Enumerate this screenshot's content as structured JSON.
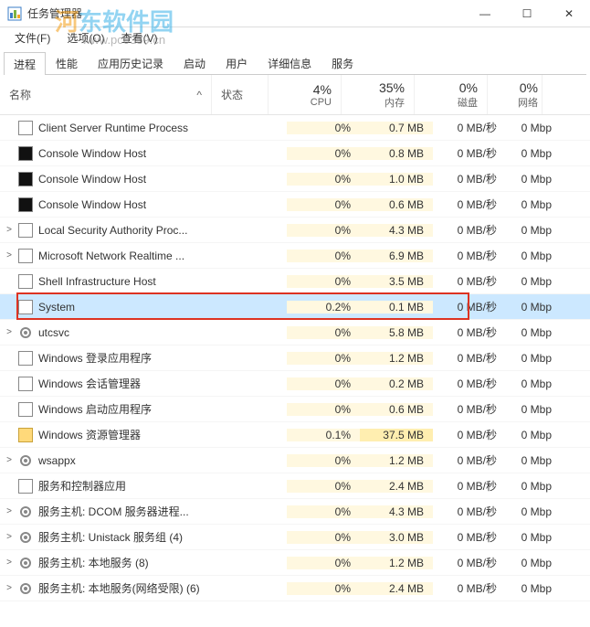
{
  "watermark": {
    "part1": "河",
    "part2": "东软件园",
    "url": "www.pc0359.cn"
  },
  "window": {
    "title": "任务管理器"
  },
  "menu": {
    "file": "文件(F)",
    "options": "选项(O)",
    "view": "查看(V)"
  },
  "win_controls": {
    "min": "—",
    "max": "☐",
    "close": "✕"
  },
  "tabs_list": [
    {
      "label": "进程",
      "active": true
    },
    {
      "label": "性能",
      "active": false
    },
    {
      "label": "应用历史记录",
      "active": false
    },
    {
      "label": "启动",
      "active": false
    },
    {
      "label": "用户",
      "active": false
    },
    {
      "label": "详细信息",
      "active": false
    },
    {
      "label": "服务",
      "active": false
    }
  ],
  "columns": {
    "name": "名称",
    "status": "状态",
    "cpu": {
      "pct": "4%",
      "label": "CPU"
    },
    "mem": {
      "pct": "35%",
      "label": "内存"
    },
    "disk": {
      "pct": "0%",
      "label": "磁盘"
    },
    "net": {
      "pct": "0%",
      "label": "网络"
    }
  },
  "processes": [
    {
      "expand": "",
      "icon": "app",
      "name": "Client Server Runtime Process",
      "cpu": "0%",
      "mem": "0.7 MB",
      "disk": "0 MB/秒",
      "net": "0 Mbp",
      "cpu_hl": 1,
      "mem_hl": 1,
      "selected": false
    },
    {
      "expand": "",
      "icon": "cmd",
      "name": "Console Window Host",
      "cpu": "0%",
      "mem": "0.8 MB",
      "disk": "0 MB/秒",
      "net": "0 Mbp",
      "cpu_hl": 1,
      "mem_hl": 1
    },
    {
      "expand": "",
      "icon": "cmd",
      "name": "Console Window Host",
      "cpu": "0%",
      "mem": "1.0 MB",
      "disk": "0 MB/秒",
      "net": "0 Mbp",
      "cpu_hl": 1,
      "mem_hl": 1
    },
    {
      "expand": "",
      "icon": "cmd",
      "name": "Console Window Host",
      "cpu": "0%",
      "mem": "0.6 MB",
      "disk": "0 MB/秒",
      "net": "0 Mbp",
      "cpu_hl": 1,
      "mem_hl": 1
    },
    {
      "expand": ">",
      "icon": "app",
      "name": "Local Security Authority Proc...",
      "cpu": "0%",
      "mem": "4.3 MB",
      "disk": "0 MB/秒",
      "net": "0 Mbp",
      "cpu_hl": 1,
      "mem_hl": 1
    },
    {
      "expand": ">",
      "icon": "app",
      "name": "Microsoft Network Realtime ...",
      "cpu": "0%",
      "mem": "6.9 MB",
      "disk": "0 MB/秒",
      "net": "0 Mbp",
      "cpu_hl": 1,
      "mem_hl": 1
    },
    {
      "expand": "",
      "icon": "app",
      "name": "Shell Infrastructure Host",
      "cpu": "0%",
      "mem": "3.5 MB",
      "disk": "0 MB/秒",
      "net": "0 Mbp",
      "cpu_hl": 1,
      "mem_hl": 1
    },
    {
      "expand": "",
      "icon": "app",
      "name": "System",
      "cpu": "0.2%",
      "mem": "0.1 MB",
      "disk": "0 MB/秒",
      "net": "0 Mbp",
      "cpu_hl": 1,
      "mem_hl": 1,
      "selected": true,
      "highlight": true
    },
    {
      "expand": ">",
      "icon": "gear",
      "name": "utcsvc",
      "cpu": "0%",
      "mem": "5.8 MB",
      "disk": "0 MB/秒",
      "net": "0 Mbp",
      "cpu_hl": 1,
      "mem_hl": 1
    },
    {
      "expand": "",
      "icon": "app",
      "name": "Windows 登录应用程序",
      "cpu": "0%",
      "mem": "1.2 MB",
      "disk": "0 MB/秒",
      "net": "0 Mbp",
      "cpu_hl": 1,
      "mem_hl": 1
    },
    {
      "expand": "",
      "icon": "app",
      "name": "Windows 会话管理器",
      "cpu": "0%",
      "mem": "0.2 MB",
      "disk": "0 MB/秒",
      "net": "0 Mbp",
      "cpu_hl": 1,
      "mem_hl": 1
    },
    {
      "expand": "",
      "icon": "app",
      "name": "Windows 启动应用程序",
      "cpu": "0%",
      "mem": "0.6 MB",
      "disk": "0 MB/秒",
      "net": "0 Mbp",
      "cpu_hl": 1,
      "mem_hl": 1
    },
    {
      "expand": "",
      "icon": "folder",
      "name": "Windows 资源管理器",
      "cpu": "0.1%",
      "mem": "37.5 MB",
      "disk": "0 MB/秒",
      "net": "0 Mbp",
      "cpu_hl": 1,
      "mem_hl": 2
    },
    {
      "expand": ">",
      "icon": "gear",
      "name": "wsappx",
      "cpu": "0%",
      "mem": "1.2 MB",
      "disk": "0 MB/秒",
      "net": "0 Mbp",
      "cpu_hl": 1,
      "mem_hl": 1
    },
    {
      "expand": "",
      "icon": "app",
      "name": "服务和控制器应用",
      "cpu": "0%",
      "mem": "2.4 MB",
      "disk": "0 MB/秒",
      "net": "0 Mbp",
      "cpu_hl": 1,
      "mem_hl": 1
    },
    {
      "expand": ">",
      "icon": "gear",
      "name": "服务主机: DCOM 服务器进程...",
      "cpu": "0%",
      "mem": "4.3 MB",
      "disk": "0 MB/秒",
      "net": "0 Mbp",
      "cpu_hl": 1,
      "mem_hl": 1
    },
    {
      "expand": ">",
      "icon": "gear",
      "name": "服务主机: Unistack 服务组 (4)",
      "cpu": "0%",
      "mem": "3.0 MB",
      "disk": "0 MB/秒",
      "net": "0 Mbp",
      "cpu_hl": 1,
      "mem_hl": 1
    },
    {
      "expand": ">",
      "icon": "gear",
      "name": "服务主机: 本地服务 (8)",
      "cpu": "0%",
      "mem": "1.2 MB",
      "disk": "0 MB/秒",
      "net": "0 Mbp",
      "cpu_hl": 1,
      "mem_hl": 1
    },
    {
      "expand": ">",
      "icon": "gear",
      "name": "服务主机: 本地服务(网络受限) (6)",
      "cpu": "0%",
      "mem": "2.4 MB",
      "disk": "0 MB/秒",
      "net": "0 Mbp",
      "cpu_hl": 1,
      "mem_hl": 1
    }
  ],
  "highlight_row_index": 7
}
